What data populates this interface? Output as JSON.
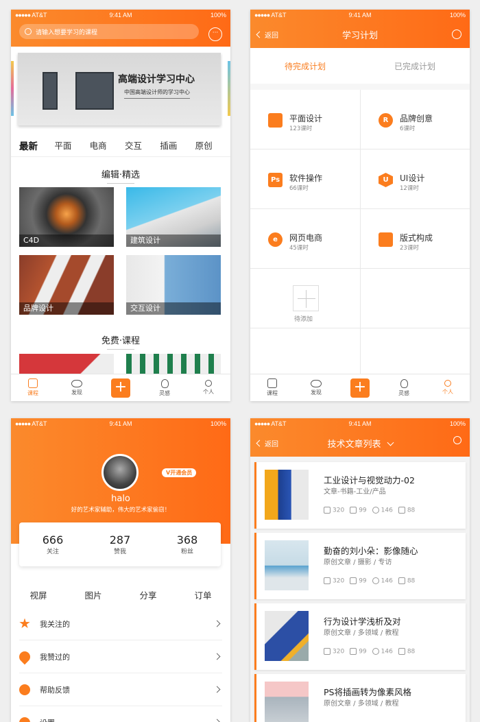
{
  "status": {
    "carrier": "AT&T",
    "time": "9:41 AM",
    "battery": "100%"
  },
  "screen1": {
    "search_placeholder": "请输入想要学习的课程",
    "banner": {
      "title": "高端设计学习中心",
      "subtitle": "中国高端设计师的学习中心"
    },
    "categories": [
      "最新",
      "平面",
      "电商",
      "交互",
      "插画",
      "原创"
    ],
    "section1": "编辑·精选",
    "cards": [
      "C4D",
      "建筑设计",
      "品牌设计",
      "交互设计"
    ],
    "section2": "免费·课程"
  },
  "tabbar": {
    "items": [
      "课程",
      "发现",
      "灵感",
      "个人"
    ]
  },
  "screen2": {
    "back": "返回",
    "title": "学习计划",
    "tabs": [
      "待完成计划",
      "已完成计划"
    ],
    "plans": [
      {
        "icon": "grid-icon",
        "glyph": "",
        "name": "平面设计",
        "sub": "123课时"
      },
      {
        "icon": "r-icon",
        "glyph": "R",
        "name": "品牌创意",
        "sub": "6课时"
      },
      {
        "icon": "ps-icon",
        "glyph": "Ps",
        "name": "软件操作",
        "sub": "66课时"
      },
      {
        "icon": "ui-icon",
        "glyph": "U",
        "name": "UI设计",
        "sub": "12课时"
      },
      {
        "icon": "e-icon",
        "glyph": "e",
        "name": "网页电商",
        "sub": "45课时"
      },
      {
        "icon": "layout-icon",
        "glyph": "",
        "name": "版式构成",
        "sub": "23课时"
      }
    ],
    "add_label": "待添加"
  },
  "screen3": {
    "vip": "V开通会员",
    "username": "halo",
    "motto": "好的艺术家辅助，伟大的艺术家偷窃！",
    "stats": [
      {
        "num": "666",
        "label": "关注"
      },
      {
        "num": "287",
        "label": "赞我"
      },
      {
        "num": "368",
        "label": "粉丝"
      }
    ],
    "quick": [
      "视屏",
      "图片",
      "分享",
      "订单"
    ],
    "menu": [
      "我关注的",
      "我赞过的",
      "帮助反馈",
      "设置"
    ]
  },
  "screen4": {
    "back": "返回",
    "title": "技术文章列表",
    "articles": [
      {
        "title": "工业设计与视觉动力-02",
        "sub": "文章-书籍-工业/产品",
        "likes": "320",
        "stars": "99",
        "comments": "146",
        "shares": "88"
      },
      {
        "title": "勤奋的刘小朵：影像随心",
        "sub": "原创文章 / 摄影 / 专访",
        "likes": "320",
        "stars": "99",
        "comments": "146",
        "shares": "88"
      },
      {
        "title": "行为设计学浅析及对",
        "sub": "原创文章 / 多领域 / 教程",
        "likes": "320",
        "stars": "99",
        "comments": "146",
        "shares": "88"
      },
      {
        "title": "PS将插画转为像素风格",
        "sub": "原创文章 / 多领域 / 教程",
        "likes": "",
        "stars": "",
        "comments": "",
        "shares": ""
      }
    ]
  },
  "colors": {
    "accent": "#fb7d1e",
    "accent_light": "#fb8a2c"
  }
}
